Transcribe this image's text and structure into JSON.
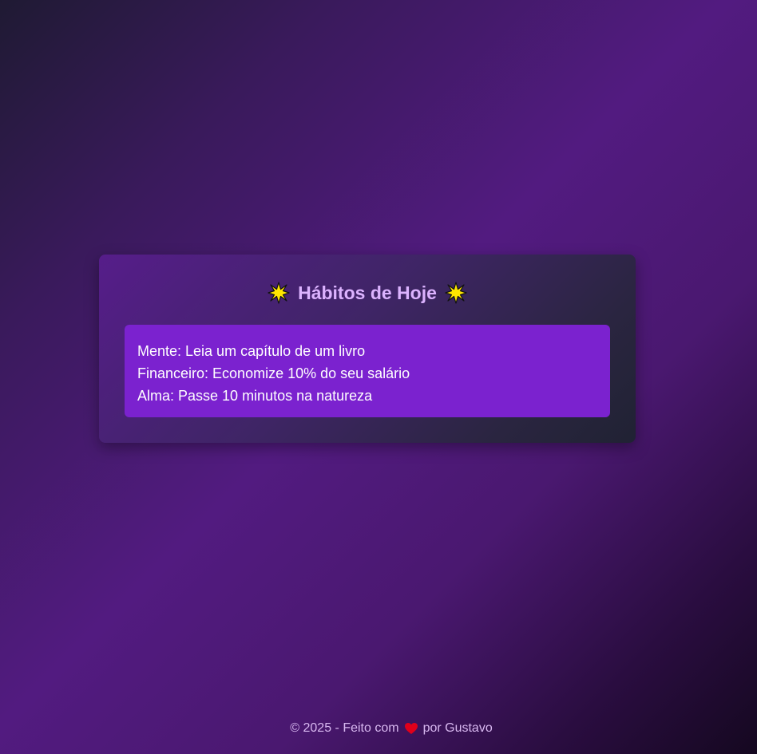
{
  "card": {
    "title": "Hábitos de Hoje",
    "title_icon": "star-icon"
  },
  "habits": [
    "Mente: Leia um capítulo de um livro",
    "Financeiro: Economize 10% do seu salário",
    "Alma: Passe 10 minutos na natureza"
  ],
  "footer": {
    "prefix": "© 2025 - Feito com",
    "icon": "heart-icon",
    "suffix": "por Gustavo"
  },
  "colors": {
    "title": "#dcb3ff",
    "habits_box": "#7b22cf",
    "star": "#ffe600",
    "heart": "#e0001a"
  }
}
